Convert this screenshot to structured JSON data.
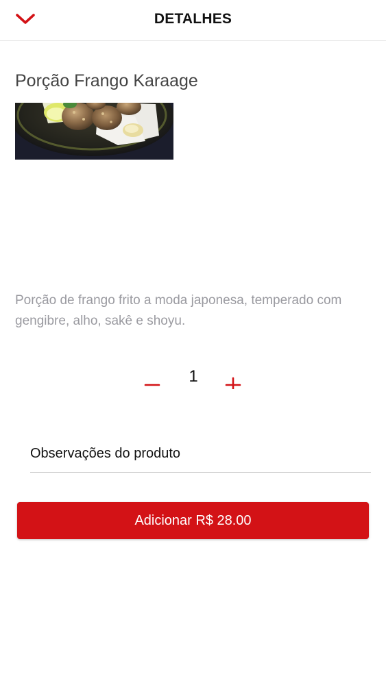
{
  "header": {
    "title": "DETALHES",
    "back_icon": "chevron-down-icon"
  },
  "product": {
    "name": "Porção Frango Karaage",
    "description": "Porção de frango frito a moda japonesa, temperado com gengibre, alho, sakê e shoyu.",
    "image_alt": "Porção Frango Karaage"
  },
  "quantity": {
    "value": "1",
    "minus_icon": "minus-icon",
    "plus_icon": "plus-icon"
  },
  "notes": {
    "placeholder": "Observações do produto",
    "value": ""
  },
  "add_button": {
    "label": "Adicionar R$ 28.00"
  },
  "colors": {
    "accent": "#d31216",
    "title": "#111111",
    "product_name": "#444444",
    "description": "#9a9aa0",
    "divider": "#e2e2e2"
  }
}
